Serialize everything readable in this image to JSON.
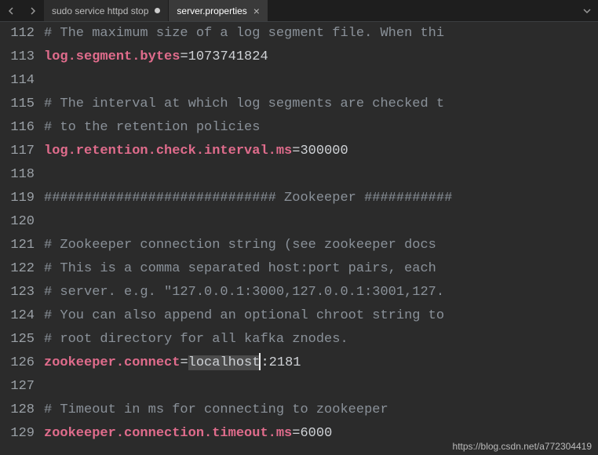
{
  "tabs": {
    "items": [
      {
        "label": "sudo service httpd stop",
        "dirty": true,
        "active": false
      },
      {
        "label": "server.properties",
        "dirty": false,
        "active": true
      }
    ]
  },
  "editor": {
    "lines": [
      {
        "num": "112",
        "type": "comment",
        "text": "# The maximum size of a log segment file. When thi"
      },
      {
        "num": "113",
        "type": "prop",
        "key": "log.segment.bytes",
        "value": "1073741824"
      },
      {
        "num": "114",
        "type": "blank",
        "text": ""
      },
      {
        "num": "115",
        "type": "comment",
        "text": "# The interval at which log segments are checked t"
      },
      {
        "num": "116",
        "type": "comment",
        "text": "# to the retention policies"
      },
      {
        "num": "117",
        "type": "prop",
        "key": "log.retention.check.interval.ms",
        "value": "300000"
      },
      {
        "num": "118",
        "type": "blank",
        "text": ""
      },
      {
        "num": "119",
        "type": "comment",
        "text": "############################# Zookeeper ###########"
      },
      {
        "num": "120",
        "type": "blank",
        "text": ""
      },
      {
        "num": "121",
        "type": "comment",
        "text": "# Zookeeper connection string (see zookeeper docs "
      },
      {
        "num": "122",
        "type": "comment",
        "text": "# This is a comma separated host:port pairs, each "
      },
      {
        "num": "123",
        "type": "comment",
        "text": "# server. e.g. \"127.0.0.1:3000,127.0.0.1:3001,127."
      },
      {
        "num": "124",
        "type": "comment",
        "text": "# You can also append an optional chroot string to"
      },
      {
        "num": "125",
        "type": "comment",
        "text": "# root directory for all kafka znodes."
      },
      {
        "num": "126",
        "type": "prop_sel",
        "key": "zookeeper.connect",
        "sel": "localhost",
        "after": ":2181"
      },
      {
        "num": "127",
        "type": "blank",
        "text": ""
      },
      {
        "num": "128",
        "type": "comment",
        "text": "# Timeout in ms for connecting to zookeeper"
      },
      {
        "num": "129",
        "type": "prop",
        "key": "zookeeper.connection.timeout.ms",
        "value": "6000"
      }
    ]
  },
  "watermark": "https://blog.csdn.net/a772304419"
}
